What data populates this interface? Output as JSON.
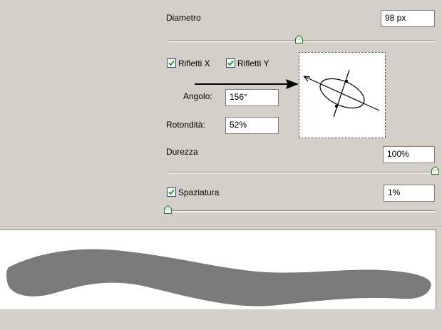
{
  "brush_options": {
    "diameter": {
      "label": "Diametro",
      "value": "98 px",
      "slider_fraction": 0.5
    },
    "flip_x": {
      "label": "Rifletti X",
      "checked": true
    },
    "flip_y": {
      "label": "Rifletti Y",
      "checked": true
    },
    "angle": {
      "label": "Angolo:",
      "value": "156°"
    },
    "roundness": {
      "label": "Rotondità:",
      "value": "52%"
    },
    "hardness": {
      "label": "Durezza",
      "value": "100%",
      "slider_fraction": 1.0
    },
    "spacing": {
      "label": "Spaziatura",
      "checked": true,
      "value": "1%",
      "slider_fraction": 0.01
    }
  },
  "icons": {
    "arrow": "annotation-arrow-icon",
    "preview": "brush-tip-preview-icon",
    "checkmark": "checkmark-icon",
    "slider_thumb": "slider-thumb-icon"
  },
  "colors": {
    "panel_bg": "#d4d0c8",
    "stroke_fill": "#7a7a7a",
    "checkbox_check": "#21a121",
    "checkbox_border": "#1c5180"
  }
}
